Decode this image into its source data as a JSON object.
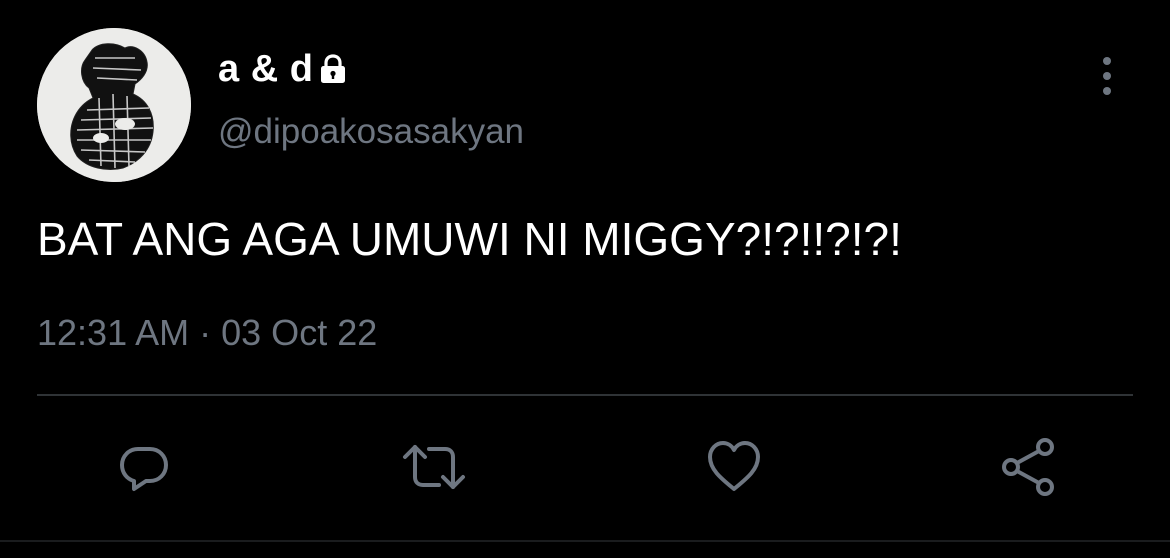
{
  "tweet": {
    "display_name": "a & d",
    "handle": "@dipoakosasakyan",
    "text": "BAT ANG AGA UMUWI NI MIGGY?!?!!?!?!",
    "time": "12:31 AM",
    "separator": "·",
    "date": "03 Oct 22",
    "protected_icon": "lock-icon",
    "more_icon": "more-vertical-icon"
  },
  "actions": [
    {
      "name": "reply",
      "icon": "reply-icon"
    },
    {
      "name": "retweet",
      "icon": "retweet-icon"
    },
    {
      "name": "like",
      "icon": "heart-icon"
    },
    {
      "name": "share",
      "icon": "share-icon"
    }
  ],
  "colors": {
    "background": "#000000",
    "primary_text": "#ffffff",
    "secondary_text": "#6e7681",
    "divider": "#2f3336",
    "action_icon": "#6e7681",
    "avatar_bg": "#ececea"
  }
}
